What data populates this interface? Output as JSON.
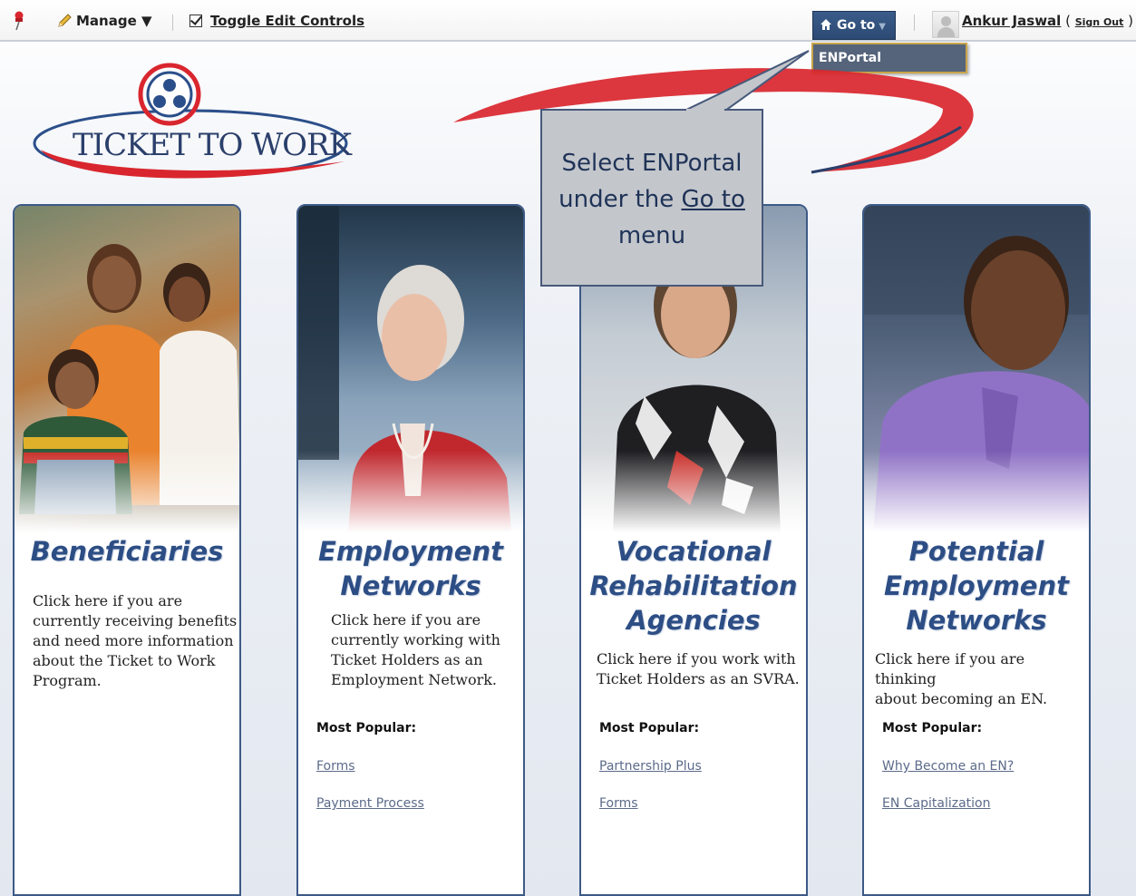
{
  "topbar": {
    "manage_label": "Manage ▼",
    "toggle_label": "Toggle Edit Controls",
    "goto_label": "Go to",
    "goto_caret": "▼",
    "goto_menu_item": "ENPortal",
    "user_name": "Ankur Jaswal",
    "signout_open": " ( ",
    "signout_label": "Sign Out",
    "signout_close": " )"
  },
  "logo": {
    "text": "TICKET TO WORK"
  },
  "callout": {
    "line1": "Select ENPortal",
    "line2_pre": "under the ",
    "line2_link": "Go to",
    "line3": "menu"
  },
  "cards": [
    {
      "title": [
        "Beneficiaries"
      ],
      "desc": [
        "Click here if you are",
        "currently receiving benefits",
        "and need more information",
        "about the Ticket to Work",
        "Program."
      ],
      "popular": "",
      "links": []
    },
    {
      "title": [
        "Employment",
        "Networks"
      ],
      "desc": [
        "Click here if you are",
        "currently working with",
        "Ticket Holders as an",
        "Employment Network."
      ],
      "popular": "Most Popular:",
      "links": [
        "Forms",
        "Payment Process"
      ]
    },
    {
      "title": [
        "Vocational",
        "Rehabilitation",
        "Agencies"
      ],
      "desc": [
        "Click here if you work with",
        "Ticket Holders as an SVRA."
      ],
      "popular": "Most Popular:",
      "links": [
        "Partnership Plus",
        "Forms"
      ]
    },
    {
      "title": [
        "Potential",
        "Employment",
        "Networks"
      ],
      "desc": [
        "Click here if you are thinking",
        "about becoming an EN."
      ],
      "popular": "Most Popular:",
      "links": [
        "Why Become an EN?",
        "EN Capitalization"
      ]
    }
  ],
  "colors": {
    "brand_blue": "#2d4e85",
    "goto_bg": "#2c4a73",
    "callout_bg": "#c3c6cb",
    "swoosh_red": "#d9262e"
  }
}
